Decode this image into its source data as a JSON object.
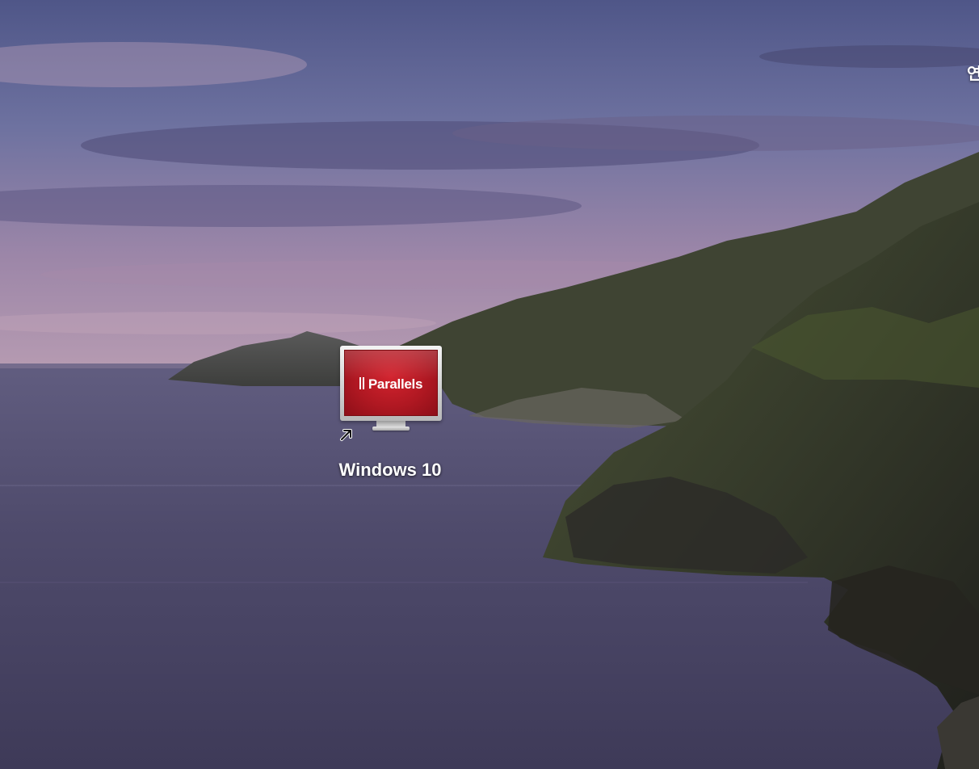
{
  "desktop": {
    "wallpaper": {
      "scene": "coastal-cliffs-at-dusk",
      "colors": {
        "sky_top": "#5d6492",
        "sky_bottom": "#b59ab1",
        "sea": "#4a4766",
        "cliff_dark": "#2b2a26",
        "cliff_green": "#3f4a2e"
      }
    },
    "edge_label": "연",
    "icons": [
      {
        "label": "Windows 10",
        "image": "parallels-vm-monitor-icon",
        "logo_text": "Parallels",
        "badge": "alias-arrow-icon",
        "colors": {
          "screen": "#b01822",
          "frame": "#d8d8d8"
        }
      }
    ]
  }
}
